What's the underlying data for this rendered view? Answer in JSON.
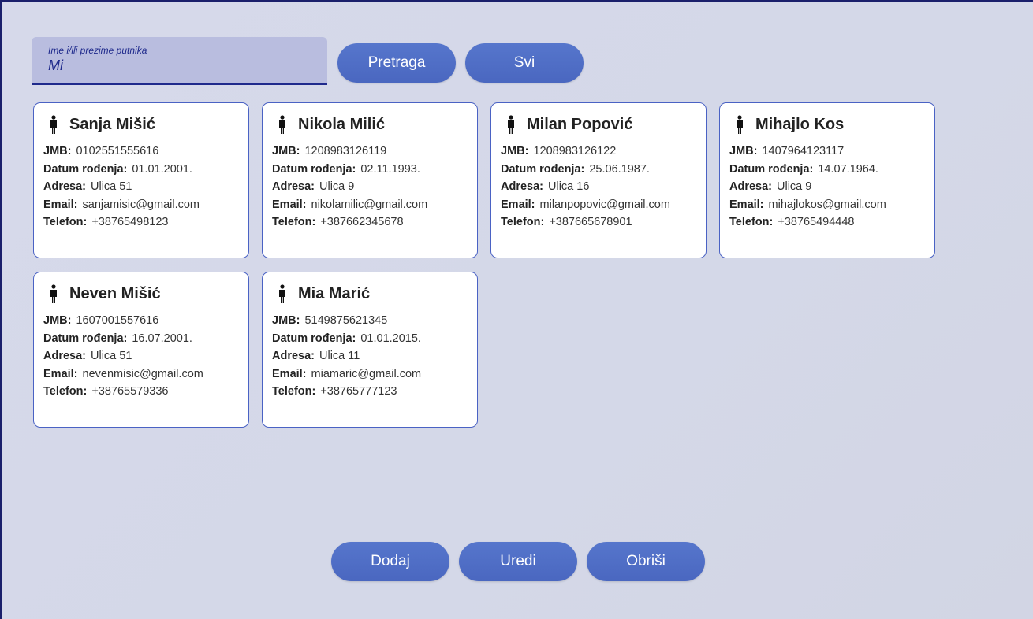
{
  "search": {
    "label": "Ime i/ili prezime putnika",
    "value": "Mi"
  },
  "buttons": {
    "search": "Pretraga",
    "all": "Svi",
    "add": "Dodaj",
    "edit": "Uredi",
    "delete": "Obriši"
  },
  "field_labels": {
    "jmb": "JMB:",
    "birth": "Datum rođenja:",
    "address": "Adresa:",
    "email": "Email:",
    "phone": "Telefon:"
  },
  "passengers": [
    {
      "name": "Sanja Mišić",
      "jmb": "0102551555616",
      "birth": "01.01.2001.",
      "address": "Ulica 51",
      "email": "sanjamisic@gmail.com",
      "phone": "+38765498123"
    },
    {
      "name": "Nikola Milić",
      "jmb": "1208983126119",
      "birth": "02.11.1993.",
      "address": "Ulica 9",
      "email": "nikolamilic@gmail.com",
      "phone": "+387662345678"
    },
    {
      "name": "Milan Popović",
      "jmb": "1208983126122",
      "birth": "25.06.1987.",
      "address": "Ulica 16",
      "email": "milanpopovic@gmail.com",
      "phone": "+387665678901"
    },
    {
      "name": "Mihajlo Kos",
      "jmb": "1407964123117",
      "birth": "14.07.1964.",
      "address": "Ulica 9",
      "email": "mihajlokos@gmail.com",
      "phone": "+38765494448"
    },
    {
      "name": "Neven Mišić",
      "jmb": "1607001557616",
      "birth": "16.07.2001.",
      "address": "Ulica 51",
      "email": "nevenmisic@gmail.com",
      "phone": "+38765579336"
    },
    {
      "name": "Mia Marić",
      "jmb": "5149875621345",
      "birth": "01.01.2015.",
      "address": "Ulica 11",
      "email": "miamaric@gmail.com",
      "phone": "+38765777123"
    }
  ],
  "icons": {
    "card_icon": "person-icon"
  },
  "colors": {
    "accent": "#4f6dc5",
    "search_bg": "#b9bddf",
    "card_border": "#4a62c4"
  }
}
